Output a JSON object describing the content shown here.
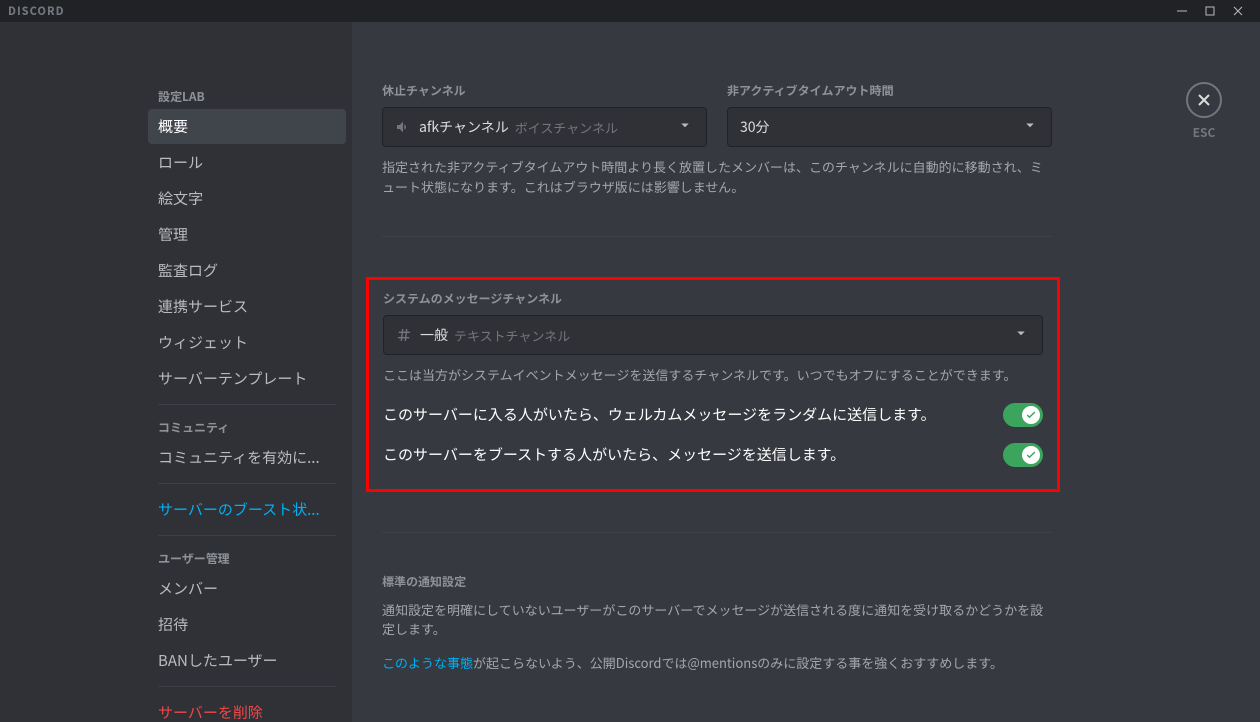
{
  "titlebar": {
    "wordmark": "DISCORD"
  },
  "close": {
    "esc": "ESC"
  },
  "sidebar": {
    "headers": {
      "settings_lab": "設定LAB",
      "community": "コミュニティ",
      "user_management": "ユーザー管理"
    },
    "items": {
      "overview": "概要",
      "roles": "ロール",
      "emoji": "絵文字",
      "moderation": "管理",
      "audit_log": "監査ログ",
      "integrations": "連携サービス",
      "widget": "ウィジェット",
      "server_template": "サーバーテンプレート",
      "enable_community": "コミュニティを有効に...",
      "server_boost": "サーバーのブースト状...",
      "members": "メンバー",
      "invites": "招待",
      "bans": "BANしたユーザー",
      "delete_server": "サーバーを削除"
    }
  },
  "afk": {
    "channel_label": "休止チャンネル",
    "channel_value": "afkチャンネル",
    "channel_sub": "ボイスチャンネル",
    "timeout_label": "非アクティブタイムアウト時間",
    "timeout_value": "30分",
    "desc": "指定された非アクティブタイムアウト時間より長く放置したメンバーは、このチャンネルに自動的に移動され、ミュート状態になります。これはブラウザ版には影響しません。"
  },
  "system": {
    "label": "システムのメッセージチャンネル",
    "channel_value": "一般",
    "channel_sub": "テキストチャンネル",
    "desc": "ここは当方がシステムイベントメッセージを送信するチャンネルです。いつでもオフにすることができます。",
    "toggle_welcome": "このサーバーに入る人がいたら、ウェルカムメッセージをランダムに送信します。",
    "toggle_boost": "このサーバーをブーストする人がいたら、メッセージを送信します。"
  },
  "notif": {
    "label": "標準の通知設定",
    "desc": "通知設定を明確にしていないユーザーがこのサーバーでメッセージが送信される度に通知を受け取るかどうかを設定します。",
    "warn_link": "このような事態",
    "warn_rest": "が起こらないよう、公開Discordでは@mentionsのみに設定する事を強くおすすめします。"
  }
}
